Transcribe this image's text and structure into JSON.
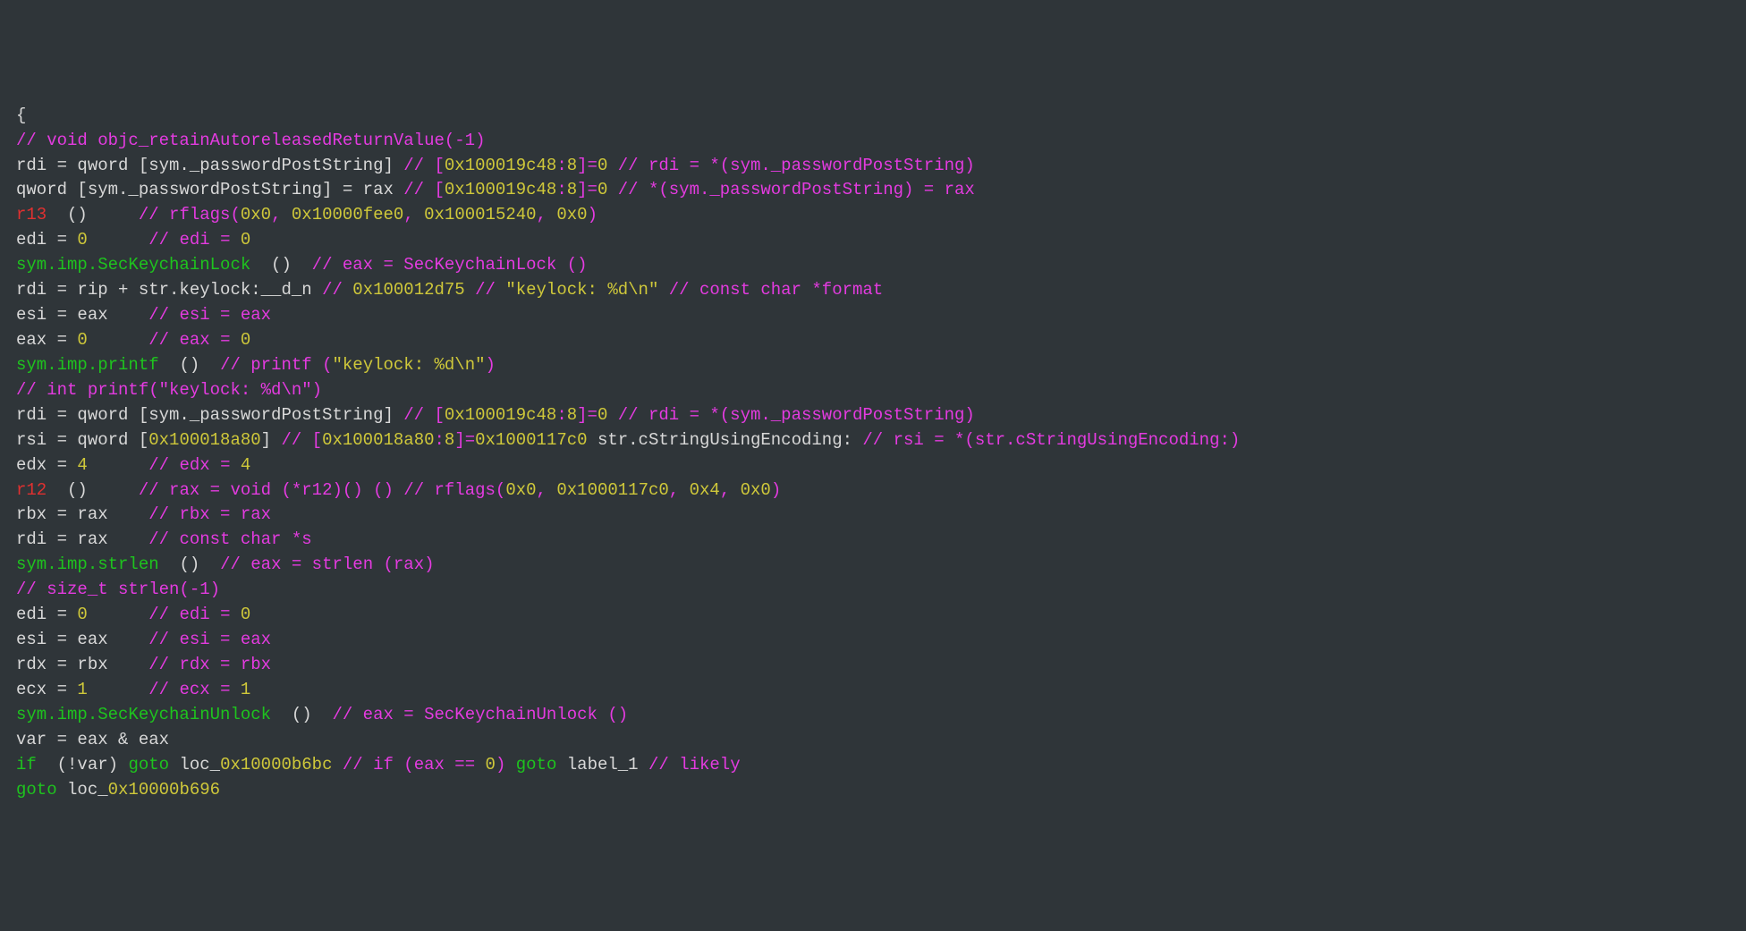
{
  "lines": [
    [
      {
        "t": "{",
        "c": "brace"
      }
    ],
    [
      {
        "t": "// void objc_retainAutoreleasedReturnValue(-1)",
        "c": "magenta"
      }
    ],
    [
      {
        "t": "rdi = qword [sym._passwordPostString] ",
        "c": "white"
      },
      {
        "t": "// [",
        "c": "magenta"
      },
      {
        "t": "0x100019c48",
        "c": "yellow"
      },
      {
        "t": ":",
        "c": "magenta"
      },
      {
        "t": "8",
        "c": "yellow"
      },
      {
        "t": "]=",
        "c": "magenta"
      },
      {
        "t": "0",
        "c": "yellow"
      },
      {
        "t": " ",
        "c": "white"
      },
      {
        "t": "// rdi = *(sym._passwordPostString)",
        "c": "magenta"
      }
    ],
    [
      {
        "t": "qword [sym._passwordPostString] = rax ",
        "c": "white"
      },
      {
        "t": "// [",
        "c": "magenta"
      },
      {
        "t": "0x100019c48",
        "c": "yellow"
      },
      {
        "t": ":",
        "c": "magenta"
      },
      {
        "t": "8",
        "c": "yellow"
      },
      {
        "t": "]=",
        "c": "magenta"
      },
      {
        "t": "0",
        "c": "yellow"
      },
      {
        "t": " ",
        "c": "white"
      },
      {
        "t": "// *(sym._passwordPostString) = rax",
        "c": "magenta"
      }
    ],
    [
      {
        "t": "r13",
        "c": "red"
      },
      {
        "t": "  ()     ",
        "c": "white"
      },
      {
        "t": "// rflags(",
        "c": "magenta"
      },
      {
        "t": "0x0",
        "c": "yellow"
      },
      {
        "t": ", ",
        "c": "magenta"
      },
      {
        "t": "0x10000fee0",
        "c": "yellow"
      },
      {
        "t": ", ",
        "c": "magenta"
      },
      {
        "t": "0x100015240",
        "c": "yellow"
      },
      {
        "t": ", ",
        "c": "magenta"
      },
      {
        "t": "0x0",
        "c": "yellow"
      },
      {
        "t": ")",
        "c": "magenta"
      }
    ],
    [
      {
        "t": "edi = ",
        "c": "white"
      },
      {
        "t": "0",
        "c": "yellow"
      },
      {
        "t": "      ",
        "c": "white"
      },
      {
        "t": "// edi = ",
        "c": "magenta"
      },
      {
        "t": "0",
        "c": "yellow"
      }
    ],
    [
      {
        "t": "sym.imp.SecKeychainLock",
        "c": "green"
      },
      {
        "t": "  ()  ",
        "c": "white"
      },
      {
        "t": "// eax = SecKeychainLock ()",
        "c": "magenta"
      }
    ],
    [
      {
        "t": "rdi = rip + str.keylock:__d_n ",
        "c": "white"
      },
      {
        "t": "// ",
        "c": "magenta"
      },
      {
        "t": "0x100012d75",
        "c": "yellow"
      },
      {
        "t": " ",
        "c": "white"
      },
      {
        "t": "// ",
        "c": "magenta"
      },
      {
        "t": "\"keylock: %d\\n\"",
        "c": "yellow"
      },
      {
        "t": " ",
        "c": "white"
      },
      {
        "t": "// const char *format",
        "c": "magenta"
      }
    ],
    [
      {
        "t": "esi = eax    ",
        "c": "white"
      },
      {
        "t": "// esi = eax",
        "c": "magenta"
      }
    ],
    [
      {
        "t": "eax = ",
        "c": "white"
      },
      {
        "t": "0",
        "c": "yellow"
      },
      {
        "t": "      ",
        "c": "white"
      },
      {
        "t": "// eax = ",
        "c": "magenta"
      },
      {
        "t": "0",
        "c": "yellow"
      }
    ],
    [
      {
        "t": "sym.imp.printf",
        "c": "green"
      },
      {
        "t": "  ()  ",
        "c": "white"
      },
      {
        "t": "// printf (",
        "c": "magenta"
      },
      {
        "t": "\"keylock: %d\\n\"",
        "c": "yellow"
      },
      {
        "t": ")",
        "c": "magenta"
      }
    ],
    [
      {
        "t": "// int printf(\"keylock: %d\\n\")",
        "c": "magenta"
      }
    ],
    [
      {
        "t": "rdi = qword [sym._passwordPostString] ",
        "c": "white"
      },
      {
        "t": "// [",
        "c": "magenta"
      },
      {
        "t": "0x100019c48",
        "c": "yellow"
      },
      {
        "t": ":",
        "c": "magenta"
      },
      {
        "t": "8",
        "c": "yellow"
      },
      {
        "t": "]=",
        "c": "magenta"
      },
      {
        "t": "0",
        "c": "yellow"
      },
      {
        "t": " ",
        "c": "white"
      },
      {
        "t": "// rdi = *(sym._passwordPostString)",
        "c": "magenta"
      }
    ],
    [
      {
        "t": "rsi = qword [",
        "c": "white"
      },
      {
        "t": "0x100018a80",
        "c": "yellow"
      },
      {
        "t": "] ",
        "c": "white"
      },
      {
        "t": "// [",
        "c": "magenta"
      },
      {
        "t": "0x100018a80",
        "c": "yellow"
      },
      {
        "t": ":",
        "c": "magenta"
      },
      {
        "t": "8",
        "c": "yellow"
      },
      {
        "t": "]=",
        "c": "magenta"
      },
      {
        "t": "0x1000117c0",
        "c": "yellow"
      },
      {
        "t": " str.cStringUsingEncoding: ",
        "c": "white"
      },
      {
        "t": "// rsi = *(str.cStringUsingEncoding:)",
        "c": "magenta"
      }
    ],
    [
      {
        "t": "edx = ",
        "c": "white"
      },
      {
        "t": "4",
        "c": "yellow"
      },
      {
        "t": "      ",
        "c": "white"
      },
      {
        "t": "// edx = ",
        "c": "magenta"
      },
      {
        "t": "4",
        "c": "yellow"
      }
    ],
    [
      {
        "t": "r12",
        "c": "red"
      },
      {
        "t": "  ()     ",
        "c": "white"
      },
      {
        "t": "// rax = void (*r12)() () ",
        "c": "magenta"
      },
      {
        "t": "// rflags(",
        "c": "magenta"
      },
      {
        "t": "0x0",
        "c": "yellow"
      },
      {
        "t": ", ",
        "c": "magenta"
      },
      {
        "t": "0x1000117c0",
        "c": "yellow"
      },
      {
        "t": ", ",
        "c": "magenta"
      },
      {
        "t": "0x4",
        "c": "yellow"
      },
      {
        "t": ", ",
        "c": "magenta"
      },
      {
        "t": "0x0",
        "c": "yellow"
      },
      {
        "t": ")",
        "c": "magenta"
      }
    ],
    [
      {
        "t": "rbx = rax    ",
        "c": "white"
      },
      {
        "t": "// rbx = rax",
        "c": "magenta"
      }
    ],
    [
      {
        "t": "rdi = rax    ",
        "c": "white"
      },
      {
        "t": "// const char *s",
        "c": "magenta"
      }
    ],
    [
      {
        "t": "sym.imp.strlen",
        "c": "green"
      },
      {
        "t": "  ()  ",
        "c": "white"
      },
      {
        "t": "// eax = strlen (rax)",
        "c": "magenta"
      }
    ],
    [
      {
        "t": "// size_t strlen(-1)",
        "c": "magenta"
      }
    ],
    [
      {
        "t": "edi = ",
        "c": "white"
      },
      {
        "t": "0",
        "c": "yellow"
      },
      {
        "t": "      ",
        "c": "white"
      },
      {
        "t": "// edi = ",
        "c": "magenta"
      },
      {
        "t": "0",
        "c": "yellow"
      }
    ],
    [
      {
        "t": "esi = eax    ",
        "c": "white"
      },
      {
        "t": "// esi = eax",
        "c": "magenta"
      }
    ],
    [
      {
        "t": "rdx = rbx    ",
        "c": "white"
      },
      {
        "t": "// rdx = rbx",
        "c": "magenta"
      }
    ],
    [
      {
        "t": "ecx = ",
        "c": "white"
      },
      {
        "t": "1",
        "c": "yellow"
      },
      {
        "t": "      ",
        "c": "white"
      },
      {
        "t": "// ecx = ",
        "c": "magenta"
      },
      {
        "t": "1",
        "c": "yellow"
      }
    ],
    [
      {
        "t": "sym.imp.SecKeychainUnlock",
        "c": "green"
      },
      {
        "t": "  ()  ",
        "c": "white"
      },
      {
        "t": "// eax = SecKeychainUnlock ()",
        "c": "magenta"
      }
    ],
    [
      {
        "t": "var = eax & eax",
        "c": "white"
      }
    ],
    [
      {
        "t": "if",
        "c": "green"
      },
      {
        "t": "  (!var) ",
        "c": "white"
      },
      {
        "t": "goto",
        "c": "green"
      },
      {
        "t": " loc_",
        "c": "white"
      },
      {
        "t": "0x10000b6bc",
        "c": "yellow"
      },
      {
        "t": " ",
        "c": "white"
      },
      {
        "t": "// if (eax == ",
        "c": "magenta"
      },
      {
        "t": "0",
        "c": "yellow"
      },
      {
        "t": ") ",
        "c": "magenta"
      },
      {
        "t": "goto",
        "c": "green"
      },
      {
        "t": " label_1 ",
        "c": "white"
      },
      {
        "t": "// likely",
        "c": "magenta"
      }
    ],
    [
      {
        "t": "goto",
        "c": "green"
      },
      {
        "t": " loc_",
        "c": "white"
      },
      {
        "t": "0x10000b696",
        "c": "yellow"
      }
    ]
  ]
}
